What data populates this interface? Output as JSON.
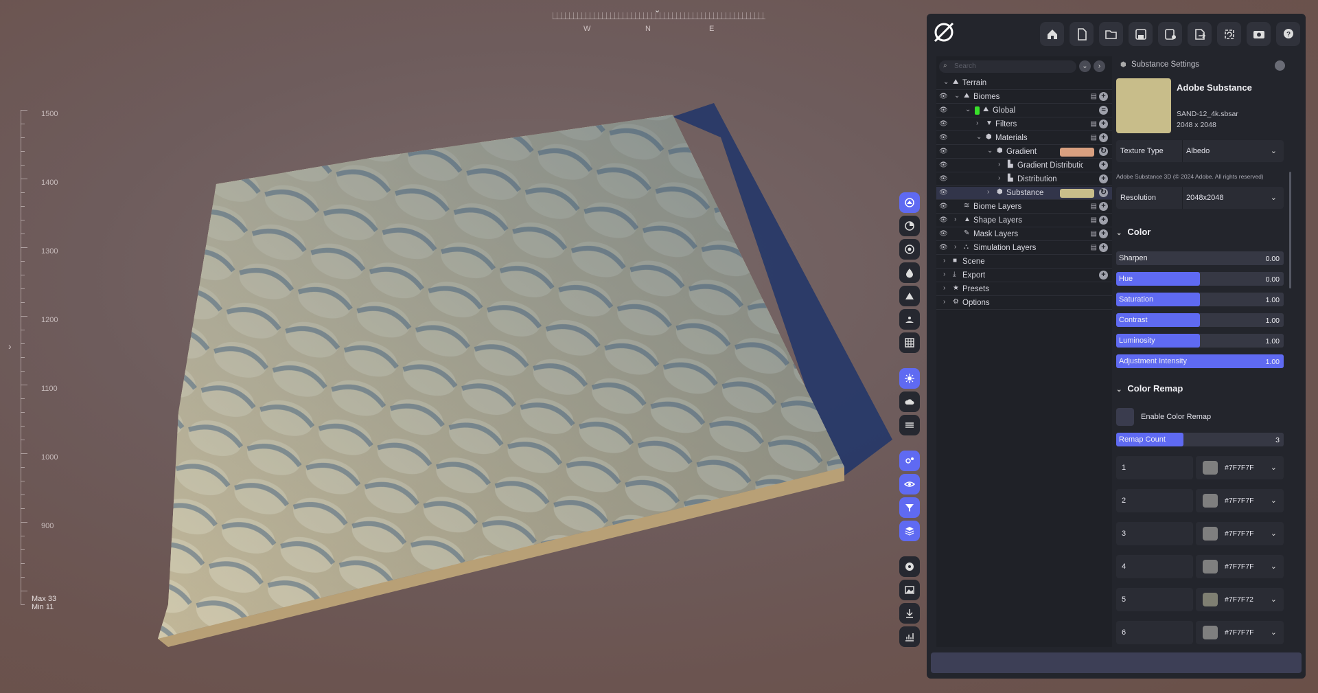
{
  "compass": {
    "labels": [
      "W",
      "N",
      "E"
    ]
  },
  "altitude": {
    "labels": [
      "1500",
      "1400",
      "1300",
      "1200",
      "1100",
      "1000",
      "900"
    ],
    "max": "Max 33",
    "min": "Min 11"
  },
  "toolbar": {
    "icons": [
      "home-icon",
      "new-file-icon",
      "open-folder-icon",
      "save-icon",
      "save-as-icon",
      "export-icon",
      "refresh-icon",
      "camera-icon",
      "help-icon"
    ]
  },
  "tree": {
    "search_placeholder": "Search",
    "rows": [
      {
        "label": "Terrain"
      },
      {
        "label": "Biomes"
      },
      {
        "label": "Global"
      },
      {
        "label": "Filters"
      },
      {
        "label": "Materials"
      },
      {
        "label": "Gradient",
        "color": "#d9a080"
      },
      {
        "label": "Gradient Distribution"
      },
      {
        "label": "Distribution"
      },
      {
        "label": "Substance",
        "color": "#c8bd8a"
      },
      {
        "label": "Biome Layers"
      },
      {
        "label": "Shape Layers"
      },
      {
        "label": "Mask Layers"
      },
      {
        "label": "Simulation Layers"
      },
      {
        "label": "Scene"
      },
      {
        "label": "Export"
      },
      {
        "label": "Presets"
      },
      {
        "label": "Options"
      }
    ]
  },
  "settings": {
    "header": "Substance Settings",
    "title": "Adobe Substance",
    "file": "SAND-12_4k.sbsar",
    "resolution_text": "2048 x 2048",
    "texture_type": {
      "label": "Texture Type",
      "value": "Albedo"
    },
    "copyright": "Adobe Substance 3D (© 2024 Adobe. All rights reserved)",
    "resolution": {
      "label": "Resolution",
      "value": "2048x2048"
    },
    "color_section": "Color",
    "sliders": [
      {
        "label": "Sharpen",
        "value": "0.00",
        "fill": 0.0
      },
      {
        "label": "Hue",
        "value": "0.00",
        "fill": 0.5
      },
      {
        "label": "Saturation",
        "value": "1.00",
        "fill": 0.5
      },
      {
        "label": "Contrast",
        "value": "1.00",
        "fill": 0.5
      },
      {
        "label": "Luminosity",
        "value": "1.00",
        "fill": 0.5
      },
      {
        "label": "Adjustment Intensity",
        "value": "1.00",
        "fill": 1.0
      }
    ],
    "remap_section": "Color Remap",
    "enable_remap": "Enable Color Remap",
    "remap_count": {
      "label": "Remap Count",
      "value": "3",
      "fill": 0.4
    },
    "remaps": [
      {
        "n": "1",
        "hex": "#7F7F7F",
        "color": "#7f7f7f"
      },
      {
        "n": "2",
        "hex": "#7F7F7F",
        "color": "#7f7f7f"
      },
      {
        "n": "3",
        "hex": "#7F7F7F",
        "color": "#7f7f7f"
      },
      {
        "n": "4",
        "hex": "#7F7F7F",
        "color": "#7f7f7f"
      },
      {
        "n": "5",
        "hex": "#7F7F72",
        "color": "#7f7f72"
      },
      {
        "n": "6",
        "hex": "#7F7F7F",
        "color": "#7f7f7f"
      }
    ]
  },
  "colors": {
    "accent": "#5f6af2",
    "panel": "#23252c",
    "terrain": "#d8c8a0"
  }
}
